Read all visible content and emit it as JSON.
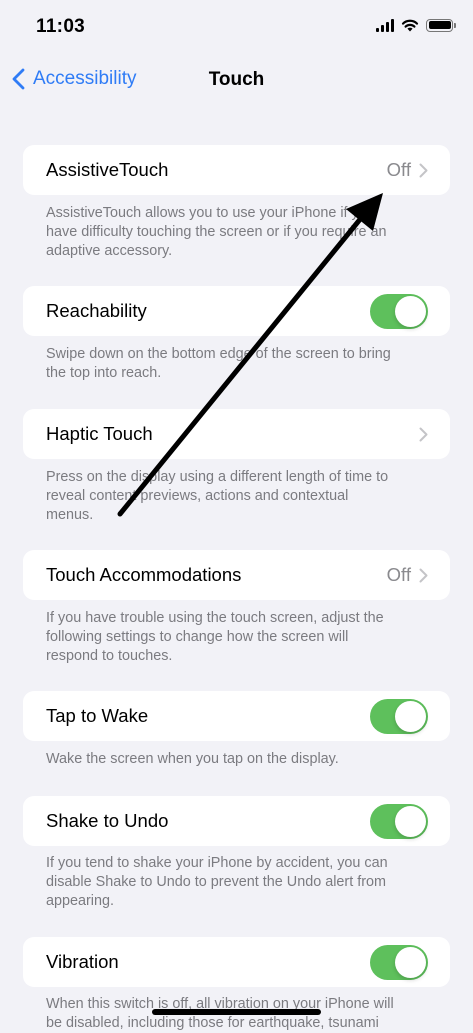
{
  "status_bar": {
    "time": "11:03",
    "icons": [
      "cellular-signal-icon",
      "wifi-icon",
      "battery-icon"
    ]
  },
  "nav": {
    "back_label": "Accessibility",
    "title": "Touch"
  },
  "settings": [
    {
      "label": "AssistiveTouch",
      "value": "Off",
      "accessory": "chevron",
      "footer": [
        "AssistiveTouch allows you to use your iPhone if you",
        "have difficulty touching the screen or if you require an",
        "adaptive accessory."
      ]
    },
    {
      "label": "Reachability",
      "accessory": "toggle",
      "toggle_on": true,
      "footer": [
        "Swipe down on the bottom edge of the screen to bring",
        "the top into reach."
      ]
    },
    {
      "label": "Haptic Touch",
      "accessory": "chevron",
      "footer": [
        "Press on the display using a different length of time to",
        "reveal content previews, actions and contextual",
        "menus."
      ]
    },
    {
      "label": "Touch Accommodations",
      "value": "Off",
      "accessory": "chevron",
      "footer": [
        "If you have trouble using the touch screen, adjust the",
        "following settings to change how the screen will",
        "respond to touches."
      ]
    },
    {
      "label": "Tap to Wake",
      "accessory": "toggle",
      "toggle_on": true,
      "footer": [
        "Wake the screen when you tap on the display."
      ]
    },
    {
      "label": "Shake to Undo",
      "accessory": "toggle",
      "toggle_on": true,
      "footer": [
        "If you tend to shake your iPhone by accident, you can",
        "disable Shake to Undo to prevent the Undo alert from",
        "appearing."
      ]
    },
    {
      "label": "Vibration",
      "accessory": "toggle",
      "toggle_on": true,
      "footer": [
        "When this switch is off, all vibration on your iPhone will",
        "be disabled, including those for earthquake, tsunami"
      ]
    }
  ],
  "colors": {
    "background": "#f2f2f7",
    "accent_blue": "#2f7cf6",
    "toggle_on_green": "#5ec05c",
    "secondary_text": "#7b7b80",
    "value_gray": "#8a8a8e"
  }
}
